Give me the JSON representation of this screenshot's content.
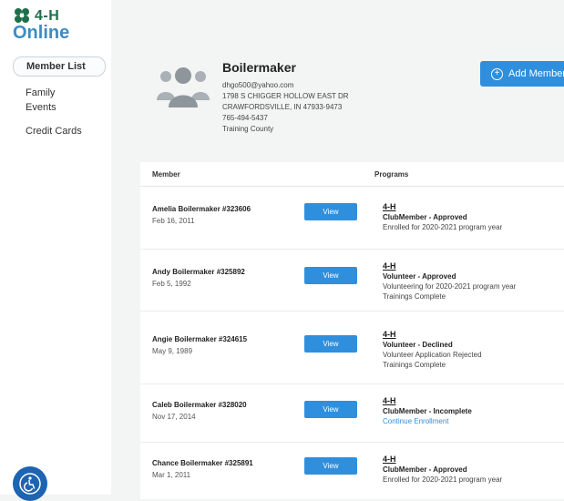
{
  "sidebar": {
    "logo": {
      "mark": "4-H",
      "name": "Online"
    },
    "items": [
      {
        "label": "Member List",
        "active": true
      },
      {
        "label": "Family",
        "active": false
      },
      {
        "label": "Events",
        "active": false
      },
      {
        "label": "Credit Cards",
        "active": false
      }
    ],
    "accessibility_icon": "wheelchair-icon"
  },
  "family": {
    "name": "Boilermaker",
    "email": "dhgo500@yahoo.com",
    "address1": "1798 S CHIGGER HOLLOW EAST DR",
    "address2": "CRAWFORDSVILLE, IN 47933-9473",
    "phone": "765-494-5437",
    "county": "Training County",
    "add_member_label": "Add Member"
  },
  "table": {
    "headers": {
      "member": "Member",
      "programs": "Programs"
    },
    "view_label": "View",
    "rows": [
      {
        "name": "Amelia Boilermaker #323606",
        "dob": "Feb 16, 2011",
        "program": "4-H",
        "status": "ClubMember - Approved",
        "line1": "Enrolled for 2020-2021 program year",
        "line2": ""
      },
      {
        "name": "Andy Boilermaker #325892",
        "dob": "Feb 5, 1992",
        "program": "4-H",
        "status": "Volunteer - Approved",
        "line1": "Volunteering for 2020-2021 program year",
        "line2": "Trainings Complete"
      },
      {
        "name": "Angie Boilermaker #324615",
        "dob": "May 9, 1989",
        "program": "4-H",
        "status": "Volunteer - Declined",
        "line1": "Volunteer Application Rejected",
        "line2": "Trainings Complete"
      },
      {
        "name": "Caleb Boilermaker #328020",
        "dob": "Nov 17, 2014",
        "program": "4-H",
        "status": "ClubMember - Incomplete",
        "link": "Continue Enrollment"
      },
      {
        "name": "Chance Boilermaker #325891",
        "dob": "Mar 1, 2011",
        "program": "4-H",
        "status": "ClubMember - Approved",
        "line1": "Enrolled for 2020-2021 program year",
        "line2": ""
      }
    ]
  },
  "colors": {
    "accent": "#2f8fdd",
    "brand_green": "#1e6e4a",
    "brand_blue": "#3c8cc4",
    "background": "#f3f4f4"
  }
}
